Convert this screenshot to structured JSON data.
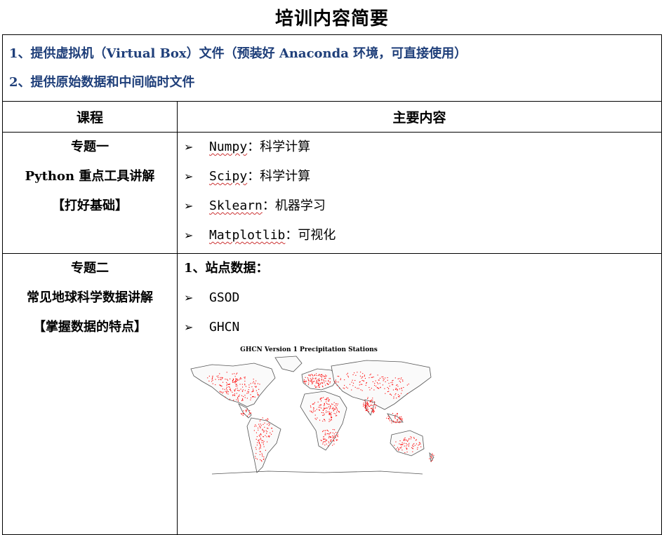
{
  "title": "培训内容简要",
  "intro": [
    "1、提供虚拟机（Virtual Box）文件（预装好 Anaconda 环境，可直接使用）",
    "2、提供原始数据和中间临时文件"
  ],
  "header": {
    "course": "课程",
    "content": "主要内容"
  },
  "topic1": {
    "name": "专题一",
    "subtitle": "Python 重点工具讲解",
    "tag": "【打好基础】",
    "items": [
      {
        "lib": "Numpy",
        "desc": "：科学计算"
      },
      {
        "lib": "Scipy",
        "desc": "：科学计算"
      },
      {
        "lib": "Sklearn",
        "desc": "：机器学习"
      },
      {
        "lib": "Matplotlib",
        "desc": "：可视化"
      }
    ]
  },
  "topic2": {
    "name": "专题二",
    "subtitle": "常见地球科学数据讲解",
    "tag": "【掌握数据的特点】",
    "section1": "1、站点数据：",
    "items": [
      "GSOD",
      "GHCN"
    ],
    "map_title": "GHCN Version 1 Precipitation Stations"
  },
  "colors": {
    "intro_text": "#1f3f7a",
    "stations": "#ff0000",
    "coastline": "#555555"
  },
  "icons": {
    "bullet": "arrow-bullet-icon"
  }
}
